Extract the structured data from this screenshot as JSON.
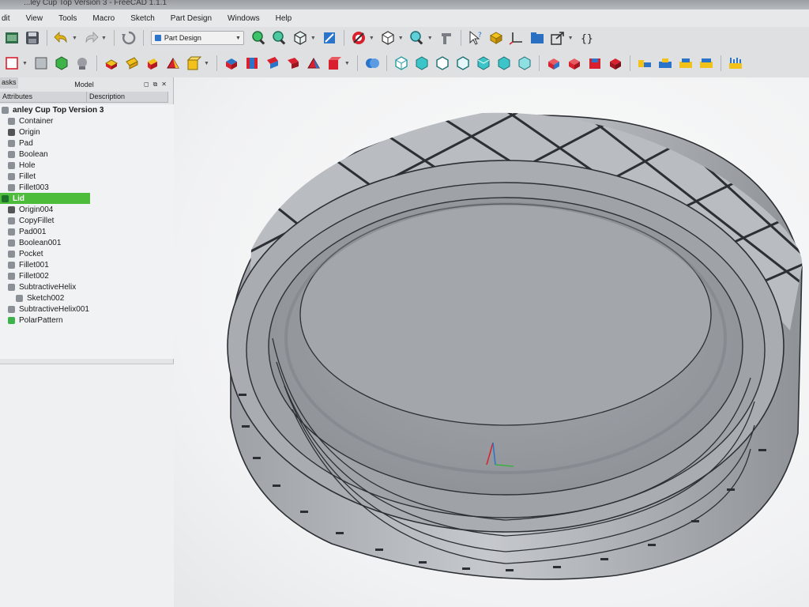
{
  "window": {
    "title": "...ley Cup Top Version 3 - FreeCAD 1.1.1"
  },
  "menu": [
    {
      "key": "edit",
      "label": "dit"
    },
    {
      "key": "view",
      "label": "View"
    },
    {
      "key": "tools",
      "label": "Tools"
    },
    {
      "key": "macro",
      "label": "Macro"
    },
    {
      "key": "sketch",
      "label": "Sketch"
    },
    {
      "key": "partdesign",
      "label": "Part Design"
    },
    {
      "key": "windows",
      "label": "Windows"
    },
    {
      "key": "help",
      "label": "Help"
    }
  ],
  "workbench": {
    "selected": "Part Design"
  },
  "panel": {
    "tab_label": "asks",
    "title": "Model",
    "columns": [
      "Attributes",
      "Description"
    ]
  },
  "tree": [
    {
      "label": "anley Cup Top Version 3",
      "icon": "document-icon",
      "bold": true
    },
    {
      "label": "Container",
      "icon": "body-icon"
    },
    {
      "label": "Origin",
      "icon": "origin-icon"
    },
    {
      "label": "Pad",
      "icon": "pad-icon"
    },
    {
      "label": "Boolean",
      "icon": "boolean-icon"
    },
    {
      "label": "Hole",
      "icon": "hole-icon"
    },
    {
      "label": "Fillet",
      "icon": "fillet-icon"
    },
    {
      "label": "Fillet003",
      "icon": "fillet-icon"
    },
    {
      "label": "Lid",
      "icon": "body-icon",
      "selected": true
    },
    {
      "label": "Origin004",
      "icon": "origin-icon"
    },
    {
      "label": "CopyFillet",
      "icon": "feature-icon"
    },
    {
      "label": "Pad001",
      "icon": "pad-icon"
    },
    {
      "label": "Boolean001",
      "icon": "boolean-icon"
    },
    {
      "label": "Pocket",
      "icon": "pocket-icon"
    },
    {
      "label": "Fillet001",
      "icon": "fillet-icon"
    },
    {
      "label": "Fillet002",
      "icon": "fillet-icon"
    },
    {
      "label": "SubtractiveHelix",
      "icon": "helix-icon"
    },
    {
      "label": "Sketch002",
      "icon": "sketch-icon"
    },
    {
      "label": "SubtractiveHelix001",
      "icon": "helix-icon"
    },
    {
      "label": "PolarPattern",
      "icon": "polar-pattern-icon"
    }
  ],
  "toolbar_icons": {
    "row1": [
      "open-icon",
      "save-icon",
      "undo-icon",
      "redo-icon",
      "refresh-icon",
      "zoom-fit-icon",
      "zoom-selection-icon",
      "view-cube-icon",
      "measure-icon",
      "draw-style-icon",
      "bounding-box-icon",
      "zoom-icon",
      "measure-tool-icon",
      "whats-this-icon",
      "part-icon",
      "axis-icon",
      "folder-icon",
      "link-icon",
      "macro-icon"
    ],
    "row2": [
      "new-body-icon",
      "clone-icon",
      "body-feature-icon",
      "shapebinder-icon",
      "attach-icon",
      "sketch-icon",
      "pad-icon",
      "revolve-icon",
      "loft-icon",
      "pipe-icon",
      "helix-icon",
      "pocket-icon",
      "hole-icon",
      "groove-icon",
      "subtractive-loft-icon",
      "subtractive-pipe-icon",
      "subtractive-helix-icon",
      "boolean-icon",
      "additive-box-icon",
      "additive-cylinder-icon",
      "additive-sphere-icon",
      "additive-cone-icon",
      "additive-ellipsoid-icon",
      "additive-torus-icon",
      "additive-prism-icon",
      "subtractive-box-icon",
      "subtractive-cylinder-icon",
      "subtractive-sphere-icon",
      "subtractive-cone-icon",
      "fillet-icon",
      "chamfer-icon",
      "draft-icon",
      "thickness-icon",
      "mirror-icon"
    ]
  },
  "colors": {
    "selection": "#4cbc3a",
    "viewport_bg": "#f1f2f3",
    "model_gray": "#b4b8bd",
    "accent_blue": "#2a74c9",
    "feature_red": "#d8202e",
    "feature_yellow": "#f2c21a",
    "cyan": "#3cc5c8"
  }
}
